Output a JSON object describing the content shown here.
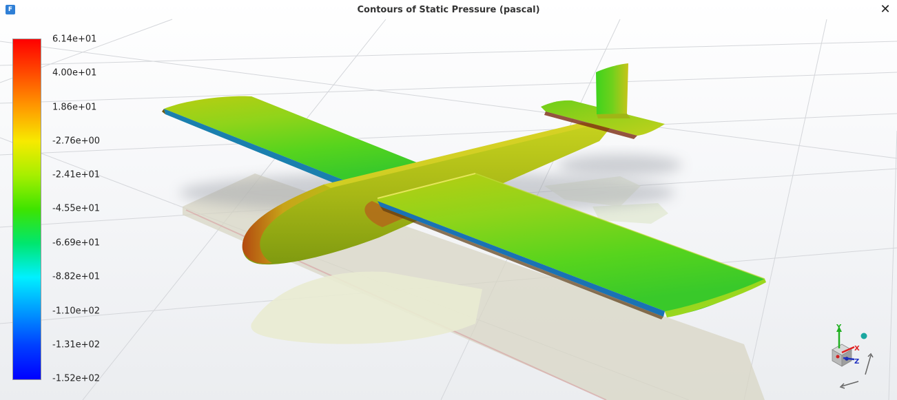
{
  "window": {
    "title": "Contours of Static Pressure (pascal)",
    "app_icon_letter": "F",
    "close_glyph": "✕"
  },
  "colorbar": {
    "labels": [
      "6.14e+01",
      "4.00e+01",
      "1.86e+01",
      "-2.76e+00",
      "-2.41e+01",
      "-4.55e+01",
      "-6.69e+01",
      "-8.82e+01",
      "-1.10e+02",
      "-1.31e+02",
      "-1.52e+02"
    ],
    "colors_top_to_bottom": [
      "#ff0000",
      "#ff9a00",
      "#f7ea00",
      "#3ee400",
      "#00f0ff",
      "#0040ff",
      "#0000ff"
    ]
  },
  "triad": {
    "axis_x": "X",
    "axis_y": "Y",
    "axis_z": "Z",
    "x_color": "#e02020",
    "y_color": "#20b020",
    "z_color": "#2030c0"
  }
}
